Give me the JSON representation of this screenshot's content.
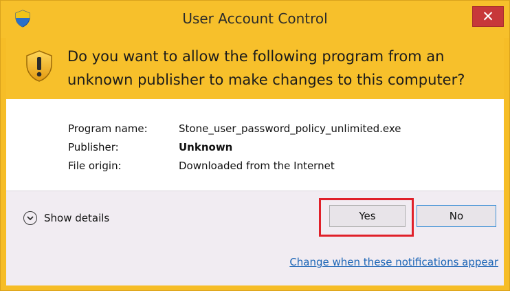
{
  "window": {
    "title": "User Account Control",
    "close_label": "✕"
  },
  "banner": {
    "question": "Do you want to allow the following program from an unknown publisher to make changes to this computer?"
  },
  "info": {
    "program_label": "Program name:",
    "program_value": "Stone_user_password_policy_unlimited.exe",
    "publisher_label": "Publisher:",
    "publisher_value": "Unknown",
    "origin_label": "File origin:",
    "origin_value": "Downloaded from the Internet"
  },
  "footer": {
    "details_label": "Show details",
    "yes_label": "Yes",
    "no_label": "No",
    "link_text": "Change when these notifications appear"
  },
  "icons": {
    "title_icon": "uac-shield-icon",
    "banner_icon": "warning-shield-icon",
    "details_icon": "chevron-down-icon"
  },
  "colors": {
    "accent_yellow": "#f7c02b",
    "close_red": "#c7383a",
    "highlight_red": "#e0202a",
    "link_blue": "#1c65b6"
  }
}
